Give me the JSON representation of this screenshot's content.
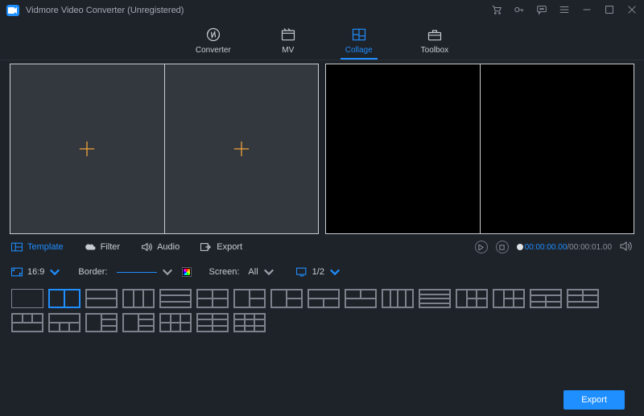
{
  "app": {
    "title": "Vidmore Video Converter (Unregistered)"
  },
  "tabs": {
    "converter": "Converter",
    "mv": "MV",
    "collage": "Collage",
    "toolbox": "Toolbox",
    "active": "collage"
  },
  "subtabs": {
    "template": "Template",
    "filter": "Filter",
    "audio": "Audio",
    "export": "Export"
  },
  "player": {
    "current": "00:00:00.00",
    "total": "00:00:01.00"
  },
  "options": {
    "ratio_label": "16:9",
    "border_label": "Border:",
    "screen_label": "Screen:",
    "screen_value": "All",
    "pager": "1/2"
  },
  "footer": {
    "export": "Export"
  }
}
